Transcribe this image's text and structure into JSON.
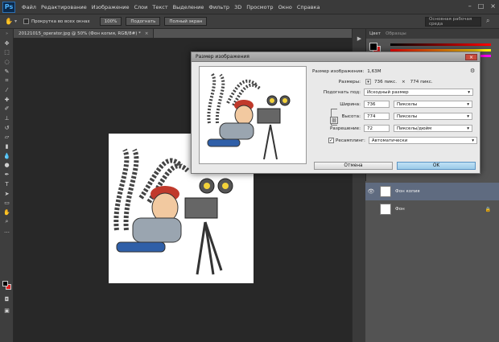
{
  "app": {
    "logo": "Ps"
  },
  "menubar": {
    "items": [
      "Файл",
      "Редактирование",
      "Изображение",
      "Слои",
      "Текст",
      "Выделение",
      "Фильтр",
      "3D",
      "Просмотр",
      "Окно",
      "Справка"
    ]
  },
  "options_bar": {
    "scroll_all_label": "Прокрутка во всех окнах",
    "zoom_100": "100%",
    "fit_label": "Подогнать",
    "full_screen_label": "Полный экран",
    "workspace": "Основная рабочая среда"
  },
  "document": {
    "tab_title": "20121015_operator.jpg @ 50% (Фон копия, RGB/8#) *"
  },
  "right_panel": {
    "tabs": [
      "Цвет",
      "Образцы"
    ]
  },
  "layers": {
    "items": [
      {
        "name": "Фон копия",
        "selected": true
      },
      {
        "name": "Фон",
        "selected": false,
        "locked": true
      }
    ]
  },
  "dialog": {
    "title": "Размер изображения",
    "image_size_label": "Размер изображения:",
    "image_size_value": "1,63М",
    "dimensions_label": "Размеры:",
    "dimensions_w": "736 пикс.",
    "dimensions_x": "×",
    "dimensions_h": "774 пикс.",
    "fit_to_label": "Подогнать под:",
    "fit_to_value": "Исходный размер",
    "width_label": "Ширина:",
    "width_value": "736",
    "width_unit": "Пикселы",
    "height_label": "Высота:",
    "height_value": "774",
    "height_unit": "Пикселы",
    "resolution_label": "Разрешение:",
    "resolution_value": "72",
    "resolution_unit": "Пикселы/дюйм",
    "resample_label": "Ресамплинг:",
    "resample_checked": true,
    "resample_value": "Автоматически",
    "cancel_label": "Отмена",
    "ok_label": "OK"
  }
}
